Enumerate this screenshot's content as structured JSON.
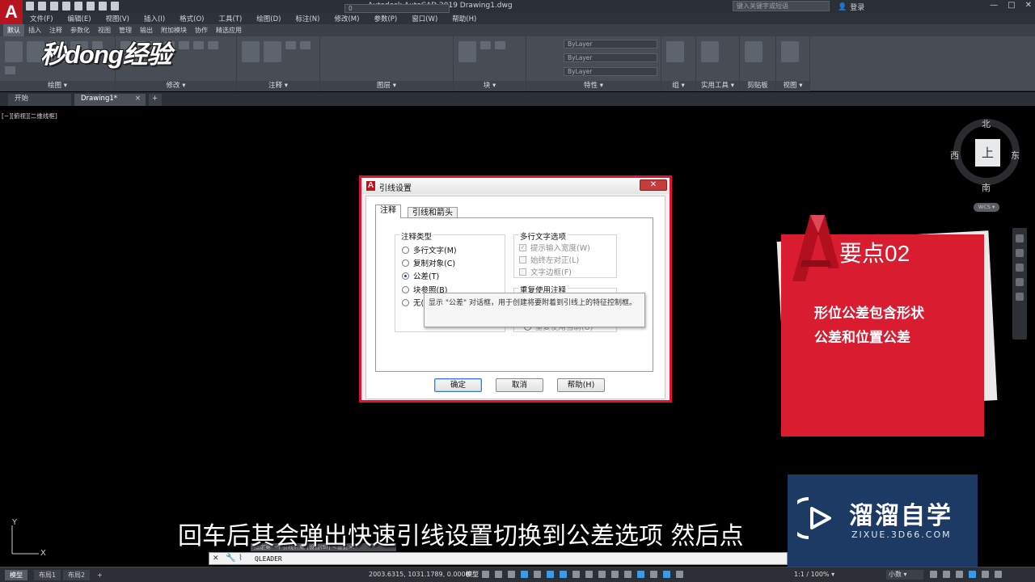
{
  "title_bar": {
    "logo": "A",
    "title": "Autodesk AutoCAD 2019    Drawing1.dwg",
    "search_placeholder": "键入关键字或短语",
    "signin": "登录",
    "controls": [
      "—",
      "□",
      "✕"
    ]
  },
  "menu": [
    "文件(F)",
    "编辑(E)",
    "视图(V)",
    "插入(I)",
    "格式(O)",
    "工具(T)",
    "绘图(D)",
    "标注(N)",
    "修改(M)",
    "参数(P)",
    "窗口(W)",
    "帮助(H)"
  ],
  "ribbon_tabs": [
    "默认",
    "插入",
    "注释",
    "参数化",
    "视图",
    "管理",
    "输出",
    "附加模块",
    "协作",
    "精选应用"
  ],
  "ribbon_panels": [
    "绘图 ▾",
    "修改 ▾",
    "注释 ▾",
    "图层 ▾",
    "块 ▾",
    "特性 ▾",
    "组 ▾",
    "实用工具 ▾",
    "剪贴板",
    "视图 ▾"
  ],
  "ribbon_combos": [
    "ByLayer",
    "ByLayer",
    "ByLayer",
    "0"
  ],
  "brand_overlay": "秒dong经验",
  "doc_tabs": {
    "start": "开始",
    "drawing": "Drawing1*",
    "close": "×",
    "add": "+"
  },
  "viewport_label": "[−][俯视][二维线框]",
  "viewcube": {
    "north": "北",
    "south": "南",
    "east": "东",
    "west": "西",
    "face": "上",
    "wcs": "WCS ▾"
  },
  "dialog": {
    "title": "引线设置",
    "close": "✕",
    "tabs": [
      "注释",
      "引线和箭头"
    ],
    "annotation_type": {
      "label": "注释类型",
      "options": [
        "多行文字(M)",
        "复制对象(C)",
        "公差(T)",
        "块参照(B)",
        "无(O)"
      ],
      "selected": "公差(T)"
    },
    "mtext_options": {
      "label": "多行文字选项",
      "items": [
        "提示输入宽度(W)",
        "始终左对正(L)",
        "文字边框(F)"
      ]
    },
    "reuse": {
      "label": "重复使用注释",
      "last_item": "重复使用当前(U)"
    },
    "buttons": {
      "ok": "确定",
      "cancel": "取消",
      "help": "帮助(H)"
    },
    "tooltip": "显示 \"公差\" 对话框，用于创建将要附着到引线上的特征控制框。"
  },
  "card": {
    "heading": "要点02",
    "lines": [
      "形位公差包含形状",
      "公差和位置公差"
    ]
  },
  "watermark": {
    "title": "溜溜自学",
    "subtitle": "ZIXUE.3D66.COM"
  },
  "subtitle": "回车后其会弹出快速引线设置切换到公差选项 然后点",
  "ucs": {
    "x": "X",
    "y": "Y"
  },
  "command": {
    "history": "指定第一个引线点或 [设置(S)] <设置>:",
    "input": "QLEADER"
  },
  "status": {
    "layouts": [
      "模型",
      "布局1",
      "布局2",
      "+"
    ],
    "coords": "2003.6315, 1031.1789, 0.0000",
    "model": "模型",
    "scale": "1:1 / 100% ▾",
    "units": "小数 ▾"
  },
  "colors": {
    "accent_red": "#da1c30",
    "dialog_border": "#e1102b",
    "watermark_blue": "#1c3a63"
  }
}
